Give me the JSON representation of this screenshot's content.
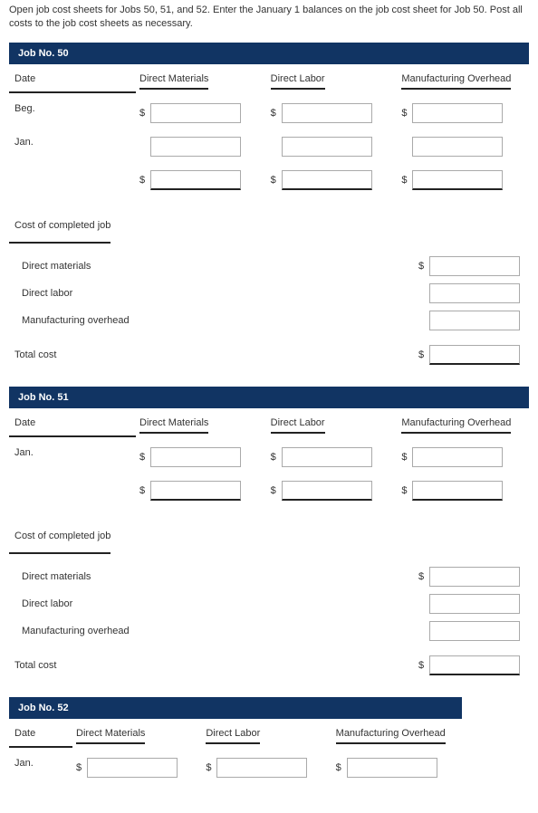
{
  "instructions": "Open job cost sheets for Jobs 50, 51, and 52. Enter the January 1 balances on the job cost sheet for Job 50. Post all costs to the job cost sheets as necessary.",
  "headers": {
    "date": "Date",
    "dm": "Direct Materials",
    "dl": "Direct Labor",
    "moh": "Manufacturing Overhead"
  },
  "completed": {
    "title": "Cost of completed job",
    "dm": "Direct materials",
    "dl": "Direct labor",
    "moh": "Manufacturing overhead",
    "total": "Total cost"
  },
  "currency": "$",
  "jobs": {
    "j50": {
      "title": "Job No. 50",
      "rows": {
        "beg": {
          "label": "Beg.",
          "dm": "",
          "dl": "",
          "moh": ""
        },
        "jan": {
          "label": "Jan.",
          "dm": "",
          "dl": "",
          "moh": ""
        },
        "sum": {
          "label": "",
          "dm": "",
          "dl": "",
          "moh": ""
        }
      },
      "completed": {
        "dm": "",
        "dl": "",
        "moh": "",
        "total": ""
      }
    },
    "j51": {
      "title": "Job No. 51",
      "rows": {
        "jan": {
          "label": "Jan.",
          "dm": "",
          "dl": "",
          "moh": ""
        },
        "sum": {
          "label": "",
          "dm": "",
          "dl": "",
          "moh": ""
        }
      },
      "completed": {
        "dm": "",
        "dl": "",
        "moh": "",
        "total": ""
      }
    },
    "j52": {
      "title": "Job No. 52",
      "rows": {
        "jan": {
          "label": "Jan.",
          "dm": "",
          "dl": "",
          "moh": ""
        }
      }
    }
  }
}
